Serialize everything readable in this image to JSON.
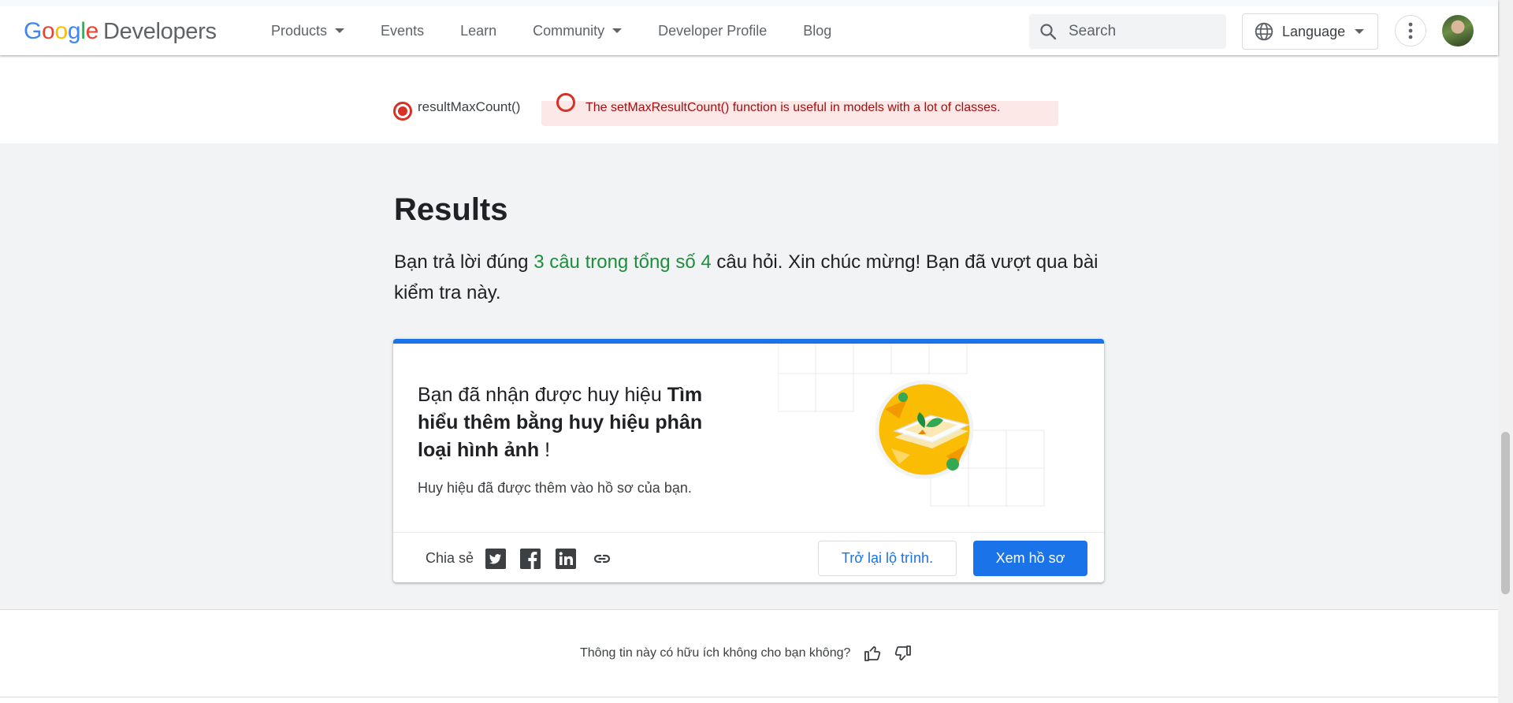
{
  "header": {
    "logo_letters": [
      "G",
      "o",
      "o",
      "g",
      "l",
      "e"
    ],
    "logo_suffix": "Developers",
    "nav": [
      {
        "label": "Products",
        "has_dropdown": true
      },
      {
        "label": "Events",
        "has_dropdown": false
      },
      {
        "label": "Learn",
        "has_dropdown": false
      },
      {
        "label": "Community",
        "has_dropdown": true
      },
      {
        "label": "Developer Profile",
        "has_dropdown": false
      },
      {
        "label": "Blog",
        "has_dropdown": false
      }
    ],
    "search_placeholder": "Search",
    "language_label": "Language"
  },
  "previous_question": {
    "option_label": "resultMaxCount()",
    "error_text": "The setMaxResultCount() function is useful in models with a lot of classes."
  },
  "results": {
    "title": "Results",
    "text_before": "Bạn trả lời đúng ",
    "score_highlight": "3 câu trong tổng số 4",
    "text_after": " câu hỏi. Xin chúc mừng! Bạn đã vượt qua bài kiểm tra này."
  },
  "badge_card": {
    "heading_prefix": "Bạn đã nhận được huy hiệu ",
    "badge_name": "Tìm hiểu thêm bằng huy hiệu phân loại hình ảnh",
    "heading_suffix": " !",
    "subtext": "Huy hiệu đã được thêm vào hồ sơ của bạn.",
    "share_label": "Chia sẻ",
    "share_icons": [
      "twitter-icon",
      "facebook-icon",
      "linkedin-icon",
      "link-icon"
    ],
    "back_button": "Trở lại lộ trình.",
    "profile_button": "Xem hồ sơ"
  },
  "feedback": {
    "question": "Thông tin này có hữu ích không cho bạn không?"
  },
  "colors": {
    "accent": "#1a73e8",
    "success": "#1e8e3e",
    "error": "#d93025",
    "section_bg": "#f1f3f4"
  }
}
